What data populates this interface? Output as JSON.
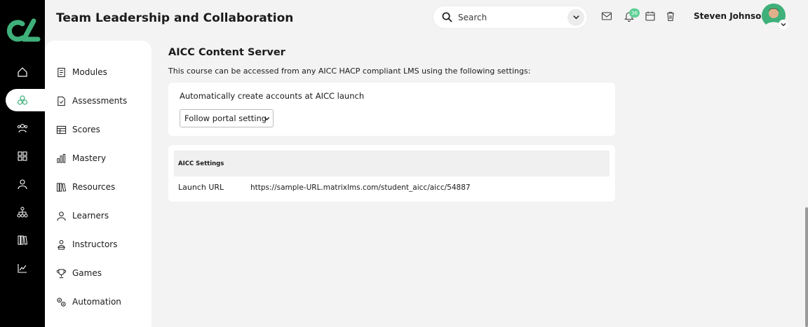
{
  "header": {
    "title": "Team Leadership and Collaboration",
    "search_placeholder": "Search",
    "notification_count": "36",
    "user_name": "Steven Johnson"
  },
  "rail": {
    "items": [
      "home-icon",
      "courses-icon",
      "users-icon",
      "apps-icon",
      "profile-icon",
      "hierarchy-icon",
      "library-icon",
      "analytics-icon"
    ],
    "active_index": 1
  },
  "subnav": {
    "items": [
      {
        "label": "Modules",
        "icon": "modules-icon"
      },
      {
        "label": "Assessments",
        "icon": "assessments-icon"
      },
      {
        "label": "Scores",
        "icon": "scores-icon"
      },
      {
        "label": "Mastery",
        "icon": "mastery-icon"
      },
      {
        "label": "Resources",
        "icon": "resources-icon"
      },
      {
        "label": "Learners",
        "icon": "learners-icon"
      },
      {
        "label": "Instructors",
        "icon": "instructors-icon"
      },
      {
        "label": "Games",
        "icon": "games-icon"
      },
      {
        "label": "Automation",
        "icon": "automation-icon"
      }
    ]
  },
  "content": {
    "title": "AICC Content Server",
    "description": "This course can be accessed from any AICC HACP compliant LMS using the following settings:",
    "auto_create_label": "Automatically create accounts at AICC launch",
    "auto_create_value": "Follow portal setting",
    "settings_header": "AICC Settings",
    "launch_url_label": "Launch URL",
    "launch_url_value": "https://sample-URL.matrixlms.com/student_aicc/aicc/54887"
  },
  "colors": {
    "rail_bg": "#000000",
    "accent_green": "#3fb07a",
    "badge_green": "#5fcf96",
    "page_bg": "#f3f3f3"
  }
}
